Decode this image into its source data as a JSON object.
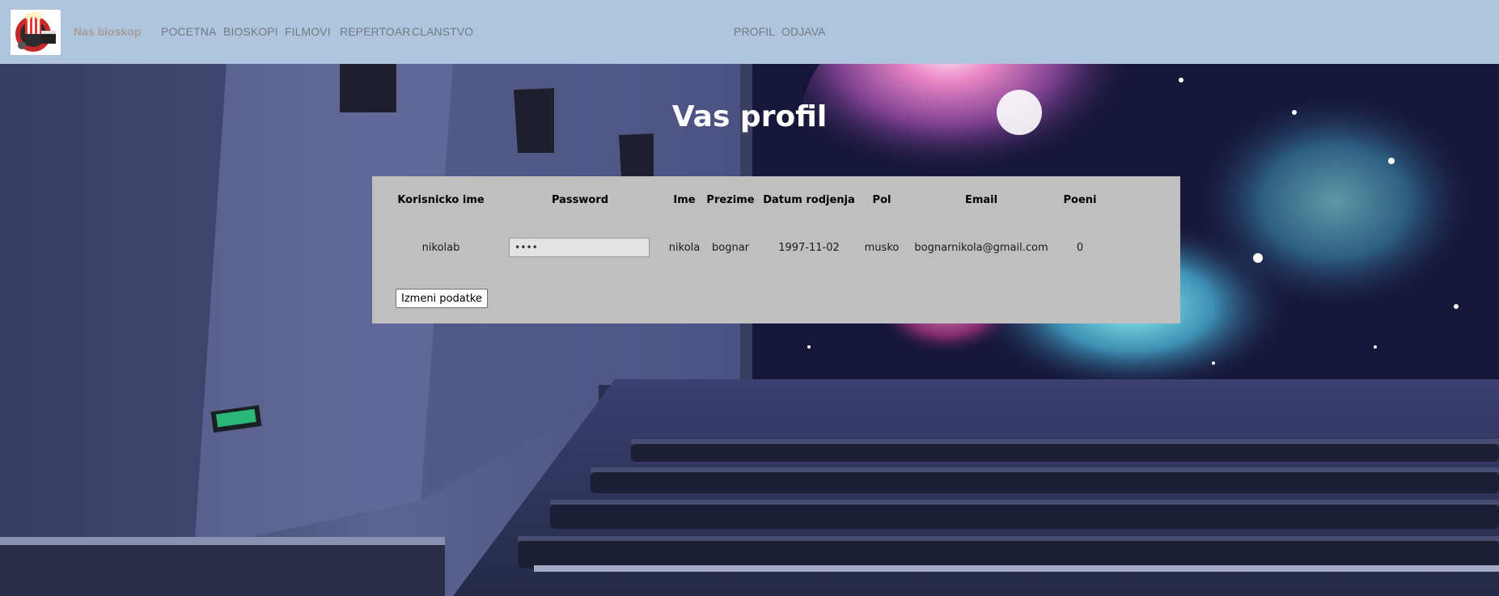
{
  "navbar": {
    "brand": "Nas bioskop",
    "links": [
      "POCETNA",
      "BIOSKOPI",
      "FILMOVI",
      "REPERTOAR",
      "CLANSTVO"
    ],
    "right_links": [
      "PROFIL",
      "ODJAVA"
    ],
    "logo_icon": "cinema-logo-icon"
  },
  "page": {
    "title": "Vas profil"
  },
  "profile": {
    "headers": [
      "Korisnicko ime",
      "Password",
      "Ime",
      "Prezime",
      "Datum rodjenja",
      "Pol",
      "Email",
      "Poeni"
    ],
    "row": {
      "username": "nikolab",
      "password": "••••",
      "ime": "nikola",
      "prezime": "bognar",
      "datum_rodjenja": "1997-11-02",
      "pol": "musko",
      "email": "bognarnikola@gmail.com",
      "poeni": "0"
    },
    "edit_button": "Izmeni podatke"
  },
  "colors": {
    "navbar_bg": "#afc4dd",
    "card_bg": "#bfbfbf",
    "title": "#ffffff"
  }
}
